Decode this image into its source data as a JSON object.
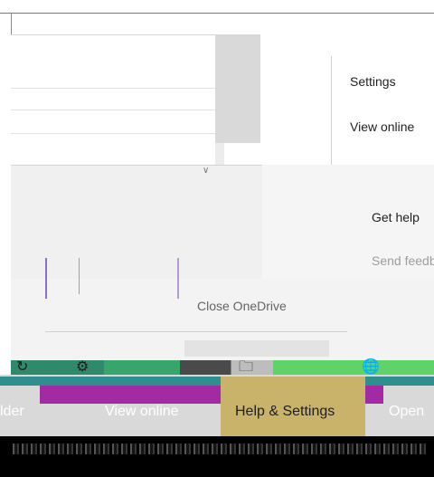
{
  "menu": {
    "items": [
      {
        "label": "Settings"
      },
      {
        "label": "View online"
      }
    ]
  },
  "secondary_menu": {
    "items": [
      {
        "label": "Get help"
      },
      {
        "label": "Send feedback"
      },
      {
        "label": "Close OneDrive"
      }
    ]
  },
  "tabs": [
    {
      "label": "lder",
      "active": false
    },
    {
      "label": "View online",
      "active": false
    },
    {
      "label": "Help & Settings",
      "active": true
    },
    {
      "label": "Open",
      "active": false
    }
  ],
  "colors": {
    "purple_accent": "#a22aa3",
    "teal_accent": "#2f8f8f",
    "active_tab": "#c9b36b",
    "taskbar": "#000000"
  },
  "icons": [
    "gear-icon",
    "folder-icon",
    "globe-icon",
    "chevron-down-icon"
  ]
}
